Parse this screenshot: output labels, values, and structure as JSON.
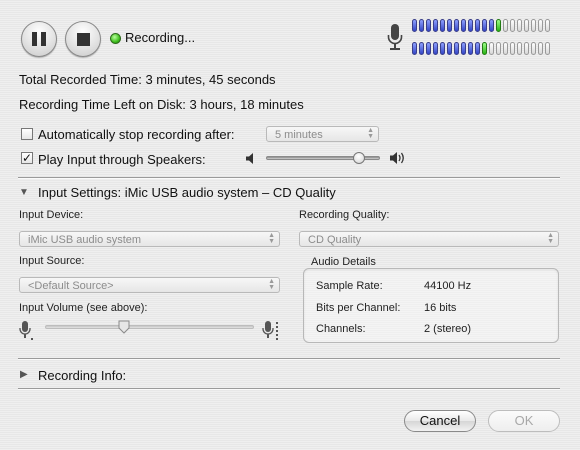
{
  "controls": {
    "status_text": "Recording...",
    "meter": {
      "row1": {
        "level": 13,
        "segments": 20
      },
      "row2": {
        "level": 11,
        "segments": 20
      }
    }
  },
  "info": {
    "total_label": "Total Recorded Time:",
    "total_value": "3 minutes, 45 seconds",
    "left_label": "Recording Time Left on Disk:",
    "left_value": "3 hours, 18 minutes"
  },
  "options": {
    "auto_stop_label": "Automatically stop recording after:",
    "auto_stop_checked": false,
    "auto_stop_value": "5 minutes",
    "play_input_label": "Play Input through Speakers:",
    "play_input_checked": true,
    "speaker_volume": 0.85
  },
  "input_settings": {
    "header": "Input Settings:",
    "summary": "iMic USB audio system – CD Quality",
    "device_label": "Input Device:",
    "device_value": "iMic USB audio system",
    "quality_label": "Recording Quality:",
    "quality_value": "CD Quality",
    "source_label": "Input Source:",
    "source_value": "<Default Source>",
    "volume_label": "Input Volume (see above):",
    "input_volume": 0.37,
    "audio_details": {
      "title": "Audio Details",
      "rows": [
        {
          "label": "Sample Rate:",
          "value": "44100 Hz"
        },
        {
          "label": "Bits per Channel:",
          "value": "16 bits"
        },
        {
          "label": "Channels:",
          "value": "2 (stereo)"
        }
      ]
    }
  },
  "recording_info": {
    "label": "Recording Info:"
  },
  "buttons": {
    "cancel": "Cancel",
    "ok": "OK"
  }
}
